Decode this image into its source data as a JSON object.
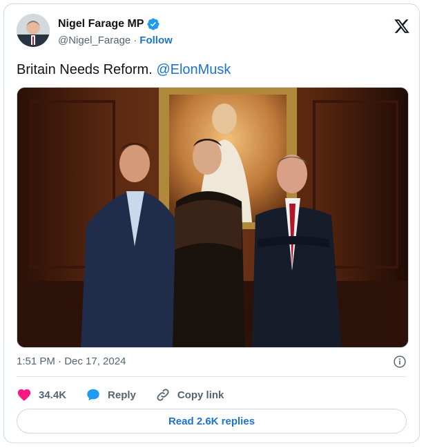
{
  "author": {
    "name": "Nigel Farage MP",
    "handle": "@Nigel_Farage",
    "separator": "·",
    "follow_label": "Follow",
    "verified_color": "#1d9bf0"
  },
  "tweet": {
    "text": "Britain Needs Reform.",
    "mention": "@ElonMusk",
    "timestamp": "1:51 PM · Dec 17, 2024"
  },
  "actions": {
    "likes": "34.4K",
    "reply_label": "Reply",
    "copy_label": "Copy link"
  },
  "read_replies_label": "Read 2.6K replies",
  "colors": {
    "link": "#1d72d0",
    "heart": "#f91880",
    "reply_bubble": "#1d9bf0"
  }
}
